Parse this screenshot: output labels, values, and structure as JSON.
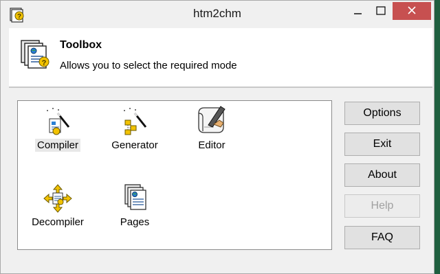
{
  "window": {
    "title": "htm2chm",
    "icons": {
      "app": "help-book-icon",
      "minimize": "minimize-icon",
      "maximize": "maximize-icon",
      "close": "close-icon"
    },
    "colors": {
      "close_button": "#c75050",
      "face": "#f0f0f0"
    }
  },
  "header": {
    "icon": "document-globe-icon",
    "title": "Toolbox",
    "subtitle": "Allows you to select the required mode"
  },
  "tools": [
    {
      "label": "Compiler",
      "icon": "compiler-wand-icon",
      "selected": true
    },
    {
      "label": "Generator",
      "icon": "generator-wand-icon",
      "selected": false
    },
    {
      "label": "Editor",
      "icon": "scroll-quill-icon",
      "selected": false
    },
    {
      "label": "Decompiler",
      "icon": "decompiler-arrows-icon",
      "selected": false
    },
    {
      "label": "Pages",
      "icon": "pages-stack-icon",
      "selected": false
    }
  ],
  "buttons": {
    "options": "Options",
    "exit": "Exit",
    "about": "About",
    "help": "Help",
    "faq": "FAQ"
  }
}
